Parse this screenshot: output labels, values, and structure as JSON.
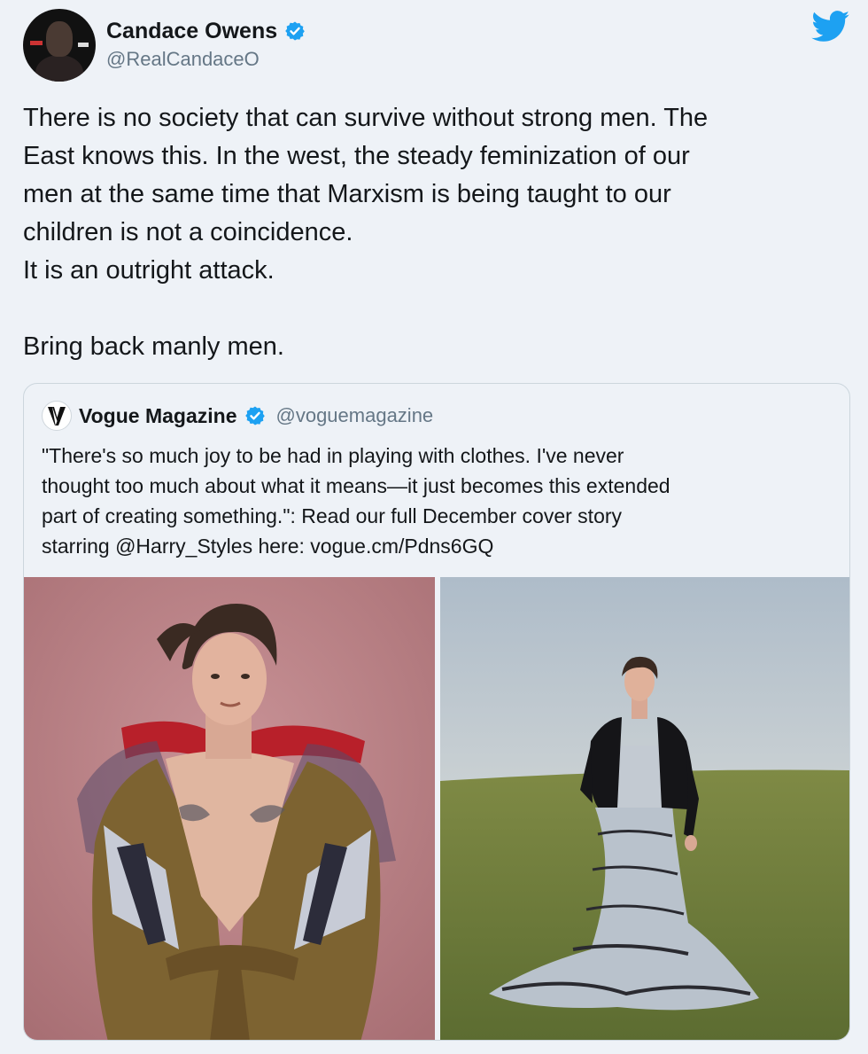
{
  "tweet": {
    "author": {
      "display_name": "Candace Owens",
      "handle": "@RealCandaceO",
      "verified": true
    },
    "text_lines": [
      "There is no society that can survive without strong men. The",
      "East knows this. In the west, the steady feminization of our",
      "men at the same time that Marxism is being taught to our",
      "children is not a coincidence.",
      "It is an outright attack.",
      "",
      "Bring back manly men."
    ],
    "icons": {
      "platform": "twitter-bird-icon",
      "verified": "verified-badge-icon"
    },
    "colors": {
      "background": "#eef2f7",
      "twitter_blue": "#1da1f2",
      "secondary_text": "#657786",
      "border": "#ccd6dd"
    }
  },
  "quoted_tweet": {
    "author": {
      "display_name": "Vogue Magazine",
      "handle": "@voguemagazine",
      "verified": true,
      "logo_letter": "V"
    },
    "text_lines": [
      "\"There's so much joy to be had in playing with clothes. I've never",
      "thought too much about what it means—it just becomes this extended",
      "part of creating something.\": Read our full December cover story",
      "starring @Harry_Styles here: vogue.cm/Pdns6GQ"
    ],
    "media": [
      {
        "icon": "photo-portrait-coat-icon"
      },
      {
        "icon": "photo-field-gown-icon"
      }
    ]
  }
}
